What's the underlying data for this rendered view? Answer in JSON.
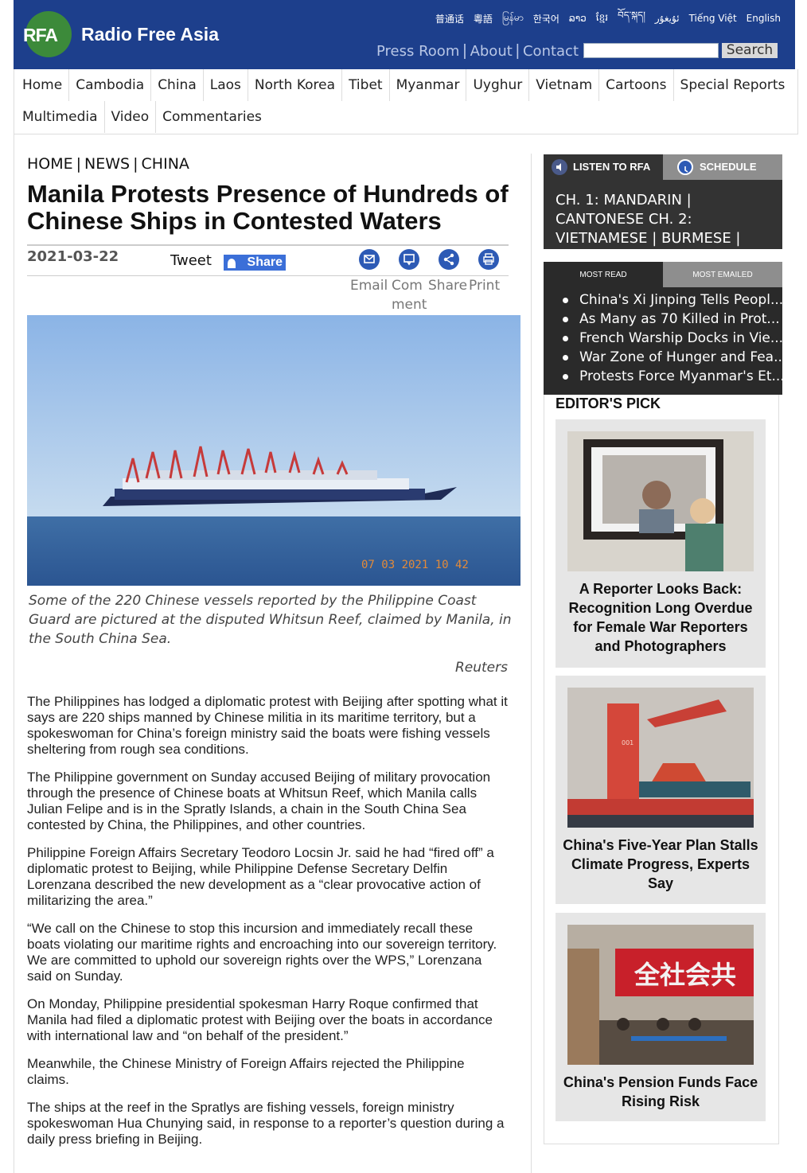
{
  "header": {
    "logo_text": "RFA",
    "site_name": "Radio Free Asia",
    "languages": [
      "普通话",
      "粵語",
      "မြန်မာ",
      "한국어",
      "ລາວ",
      "ខ្មែរ",
      "བོད་སྐད།",
      "ئۇيغۇر",
      "Tiếng Việt",
      "English"
    ],
    "top_links": [
      "Press Room",
      "About",
      "Contact"
    ],
    "search_placeholder": "",
    "search_button": "Search"
  },
  "nav": {
    "row1": [
      "Home",
      "Cambodia",
      "China",
      "Laos",
      "North Korea",
      "Tibet",
      "Myanmar",
      "Uyghur",
      "Vietnam",
      "Cartoons",
      "Special Reports"
    ],
    "row2": [
      "Multimedia",
      "Video",
      "Commentaries"
    ]
  },
  "article": {
    "breadcrumb": [
      "HOME",
      "NEWS",
      "CHINA"
    ],
    "title": "Manila Protests Presence of Hundreds of Chinese Ships in Contested Waters",
    "date": "2021-03-22",
    "tweet_label": "Tweet",
    "share_label": "Share",
    "tools": [
      {
        "label": "Email",
        "icon": "email-icon"
      },
      {
        "label": "Com ment",
        "icon": "comment-icon"
      },
      {
        "label": "Share",
        "icon": "share-icon"
      },
      {
        "label": "Print",
        "icon": "print-icon"
      }
    ],
    "photo_timestamp": "07 03 2021 10 42",
    "caption": "Some of the 220 Chinese vessels reported by the Philippine Coast Guard are pictured at the disputed Whitsun Reef, claimed by Manila, in the South China Sea.",
    "credit": "Reuters",
    "paragraphs": [
      "The Philippines has lodged a diplomatic protest with Beijing after spotting what it says are 220 ships manned by Chinese militia in its maritime territory, but a spokeswoman for China’s foreign ministry said the boats were fishing vessels sheltering from rough sea conditions.",
      "The Philippine government on Sunday accused Beijing of military provocation through the presence of Chinese boats at Whitsun Reef, which Manila calls Julian Felipe and is in the Spratly Islands, a chain in the South China Sea contested by China, the Philippines, and other countries.",
      "Philippine Foreign Affairs Secretary Teodoro Locsin Jr. said he had “fired off” a diplomatic protest to Beijing, while Philippine Defense Secretary Delfin Lorenzana described the new development as a “clear provocative action of militarizing the area.”",
      "“We call on the Chinese to stop this incursion and immediately recall these boats violating our maritime rights and encroaching into our sovereign territory. We are committed to uphold our sovereign rights over the WPS,” Lorenzana said on Sunday.",
      "On Monday, Philippine presidential spokesman Harry Roque confirmed that Manila had filed a diplomatic protest with Beijing over the boats in accordance with international law and “on behalf of the president.”",
      "Meanwhile, the Chinese Ministry of Foreign Affairs rejected the Philippine claims.",
      "The ships at the reef in the Spratlys are fishing vessels, foreign ministry spokeswoman Hua Chunying said, in response to a reporter’s question during a daily press briefing in Beijing."
    ]
  },
  "sidebar": {
    "listen_tab": "LISTEN TO RFA",
    "schedule_tab": "SCHEDULE",
    "channels": "CH. 1: MANDARIN | CANTONESE CH. 2: VIETNAMESE | BURMESE | KOREAN",
    "most_read_tab": "MOST READ",
    "most_emailed_tab": "MOST EMAILED",
    "most_read": [
      "China's Xi Jinping Tells Peopl...",
      "As Many as 70 Killed in Prot...",
      "French Warship Docks in Vie...",
      "War Zone of Hunger and Fea...",
      "Protests Force Myanmar's Et..."
    ],
    "editors_pick_title": "EDITOR'S PICK",
    "editors_pick": [
      {
        "caption": "A Reporter Looks Back: Recognition Long Overdue for Female War Reporters and Photographers"
      },
      {
        "caption": "China's Five-Year Plan Stalls Climate Progress, Experts Say"
      },
      {
        "caption": "China's Pension Funds Face Rising Risk",
        "sign_text": "全社会共"
      }
    ]
  }
}
